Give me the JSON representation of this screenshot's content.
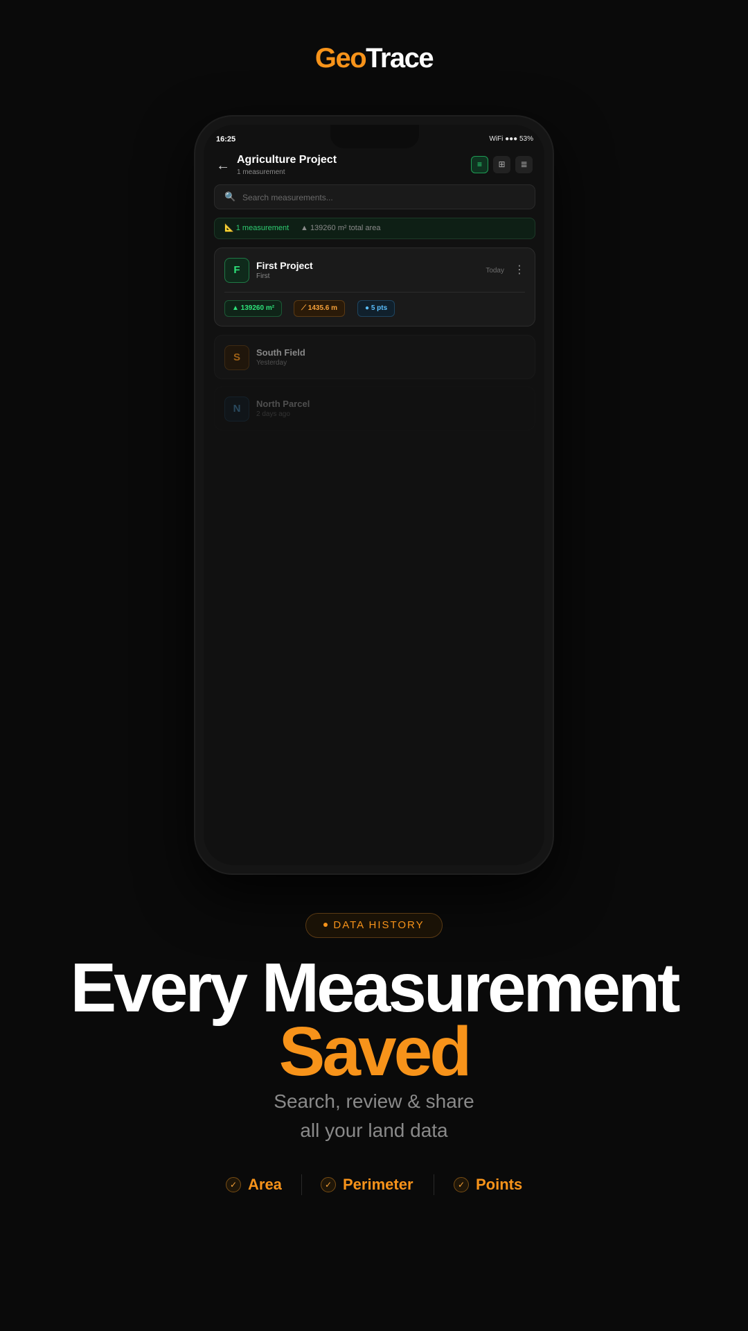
{
  "brand": {
    "geo": "Geo",
    "trace": "Trace",
    "accent": "#f7931a"
  },
  "status_bar": {
    "time": "16:25",
    "right": "WiFi ●●● 53%"
  },
  "header": {
    "back_icon": "←",
    "title": "Agriculture Project",
    "subtitle": "1 measurement",
    "view_buttons": [
      {
        "name": "list-view",
        "icon": "≡"
      },
      {
        "name": "grid-view",
        "icon": "⊞"
      },
      {
        "name": "menu",
        "icon": "≣"
      }
    ]
  },
  "search": {
    "icon": "🔍",
    "placeholder": "Search measurements..."
  },
  "summary": {
    "count": "📐 1 measurement",
    "area": "▲ 139260 m² total area"
  },
  "measurements": [
    {
      "initial": "F",
      "title": "First Project",
      "subtitle": "First",
      "date": "Today",
      "menu_icon": "⋮",
      "area": "▲  139260 m²",
      "perimeter": "⟋  1435.6 m",
      "points": "●  5 pts"
    },
    {
      "initial": "S",
      "title": "South Field",
      "subtitle": "Yesterday"
    },
    {
      "initial": "N",
      "title": "North Parcel",
      "subtitle": "2 days ago"
    }
  ],
  "marketing": {
    "tag": "DATA HISTORY",
    "headline_1": "Every Measurement",
    "headline_2": "Saved",
    "sub_1": "Search, review & share",
    "sub_2": "all your land data",
    "features": [
      "Area",
      "Perimeter",
      "Points"
    ],
    "check_icon": "✓"
  }
}
